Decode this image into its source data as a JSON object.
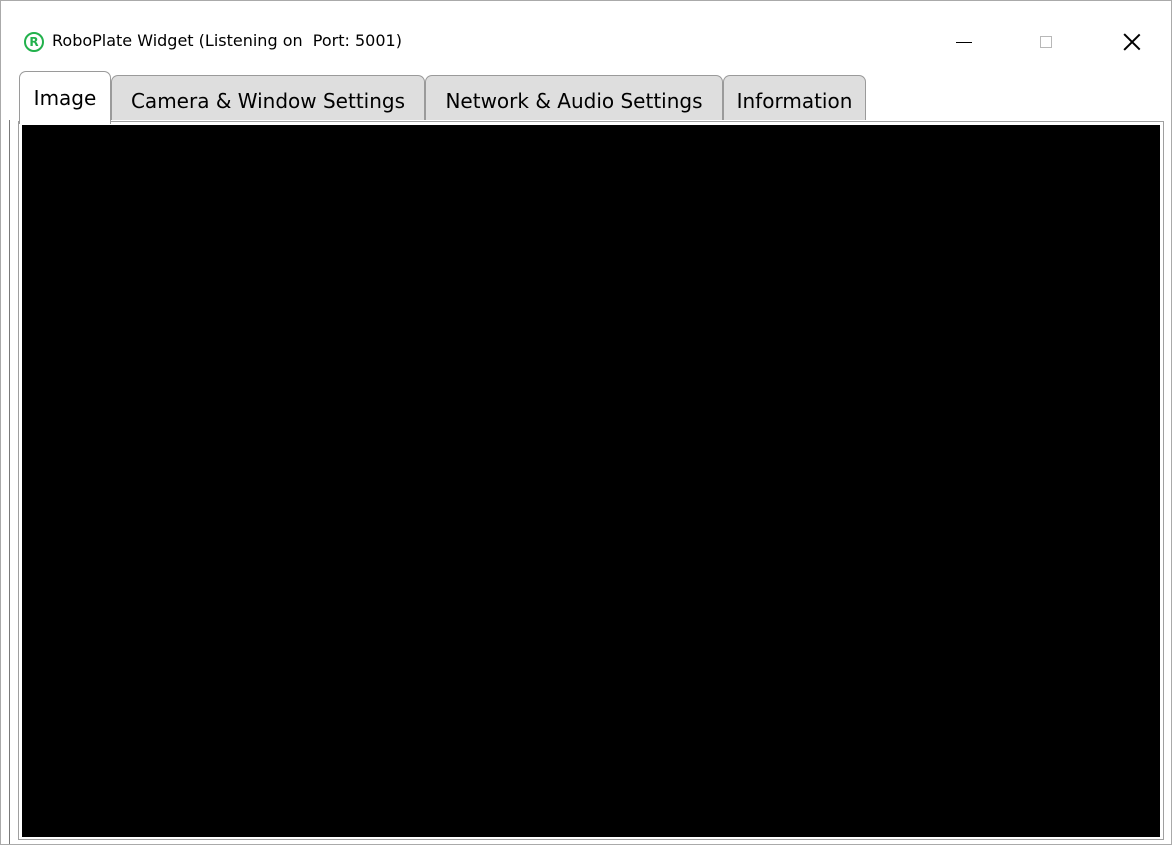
{
  "window": {
    "title": "RoboPlate Widget (Listening on  Port: 5001)",
    "app_icon_letter": "R",
    "app_icon_color": "#22b14c",
    "controls": {
      "minimize": "minimize-icon",
      "maximize": "maximize-icon",
      "close": "close-icon"
    }
  },
  "tabs": [
    {
      "label": "Image",
      "active": true
    },
    {
      "label": "Camera & Window Settings",
      "active": false
    },
    {
      "label": "Network & Audio Settings",
      "active": false
    },
    {
      "label": "Information",
      "active": false
    }
  ],
  "image_panel": {
    "background_color": "#000000"
  }
}
